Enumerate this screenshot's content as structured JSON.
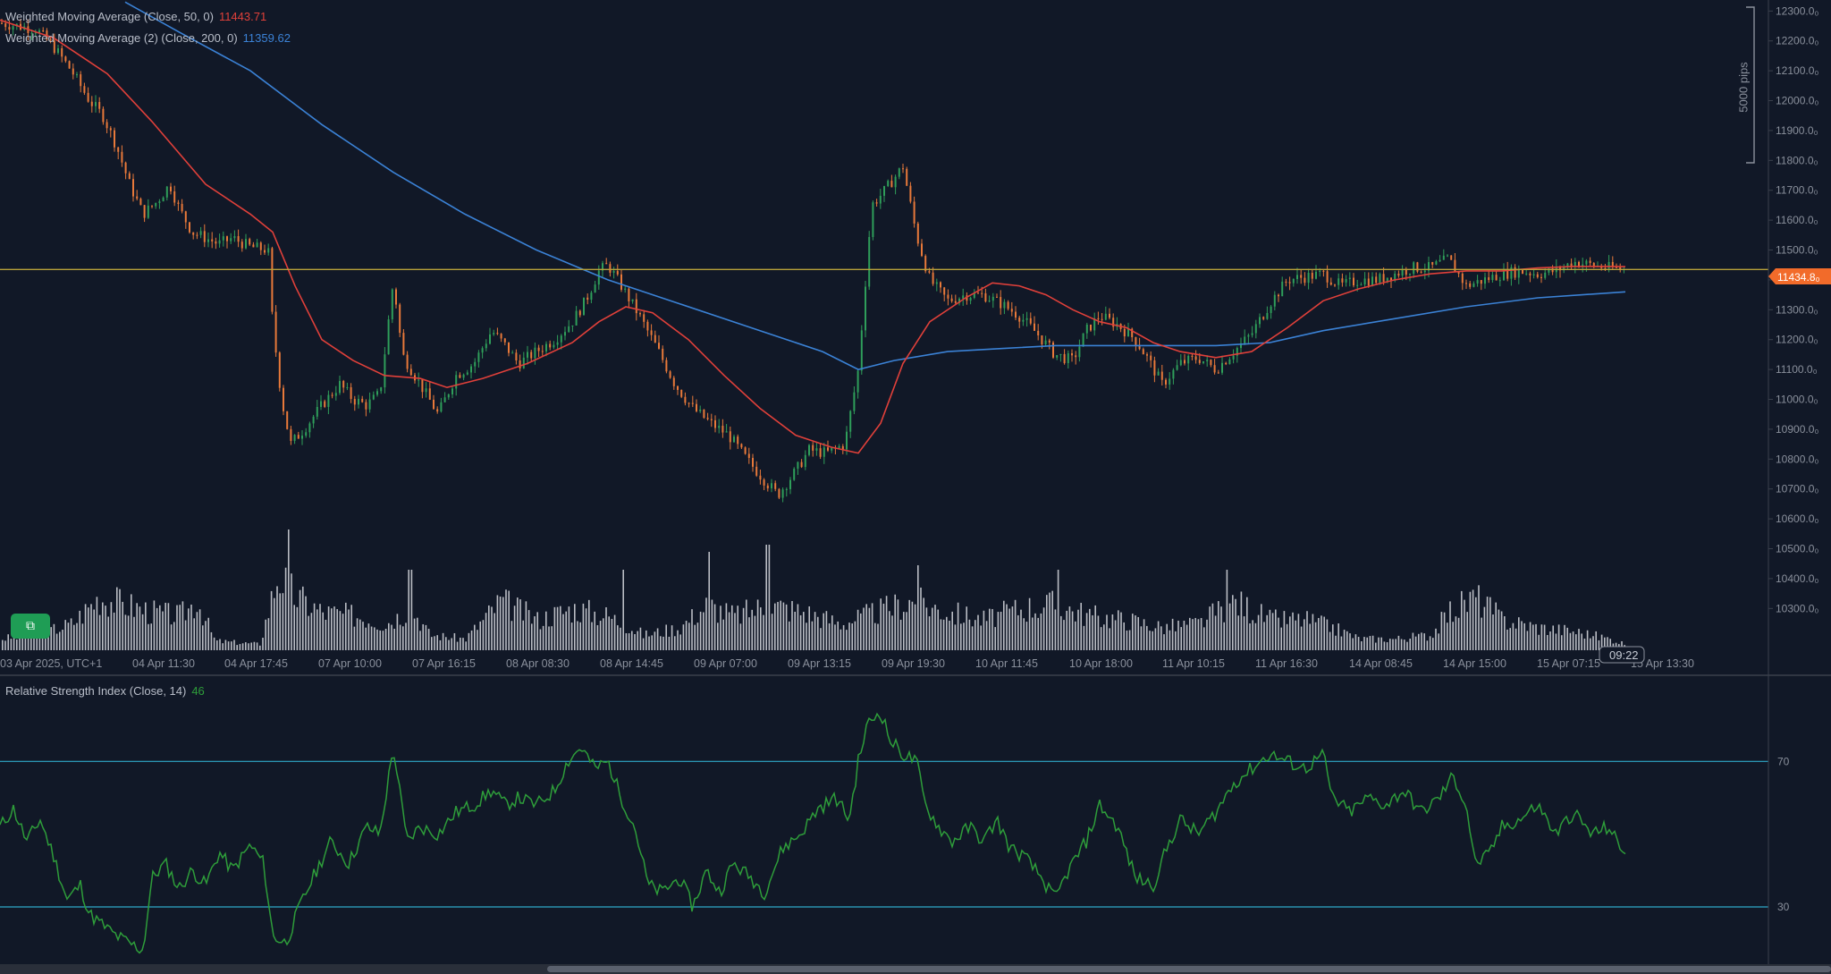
{
  "indicators": {
    "wma50": {
      "label": "Weighted Moving Average (Close, 50, 0)",
      "value": "11443.71",
      "color": "#e0403a"
    },
    "wma200": {
      "label": "Weighted Moving Average (2) (Close, 200, 0)",
      "value": "11359.62",
      "color": "#3b82d6"
    },
    "rsi": {
      "label": "Relative Strength Index (Close, 14)",
      "value": "46",
      "color": "#2e9d3a"
    }
  },
  "price_badge": "11434.8₀",
  "measure_label": "5000 pips",
  "time_badge": "09:22",
  "chart_data": {
    "type": "candlestick",
    "price_axis": {
      "ticks": [
        "12300.0₀",
        "12200.0₀",
        "12100.0₀",
        "12000.0₀",
        "11900.0₀",
        "11800.0₀",
        "11700.0₀",
        "11600.0₀",
        "11500.0₀",
        "11400.0₀",
        "11300.0₀",
        "11200.0₀",
        "11100.0₀",
        "11000.0₀",
        "10900.0₀",
        "10800.0₀",
        "10700.0₀",
        "10600.0₀",
        "10500.0₀",
        "10400.0₀",
        "10300.0₀"
      ],
      "ylim": [
        10250,
        12310
      ]
    },
    "time_axis": [
      "03 Apr 2025, UTC+1",
      "04 Apr 11:30",
      "04 Apr 17:45",
      "07 Apr 10:00",
      "07 Apr 16:15",
      "08 Apr 08:30",
      "08 Apr 14:45",
      "09 Apr 07:00",
      "09 Apr 13:15",
      "09 Apr 19:30",
      "10 Apr 11:45",
      "10 Apr 18:00",
      "11 Apr 10:15",
      "11 Apr 16:30",
      "14 Apr 08:45",
      "14 Apr 15:00",
      "15 Apr 07:15",
      "15 Apr 13:30"
    ],
    "horizontal_line": {
      "price": 11434.8,
      "color": "#b8a23a"
    },
    "price_path": [
      [
        0,
        12260
      ],
      [
        20,
        12250
      ],
      [
        40,
        12240
      ],
      [
        60,
        12180
      ],
      [
        80,
        12100
      ],
      [
        100,
        12000
      ],
      [
        115,
        11950
      ],
      [
        130,
        11850
      ],
      [
        145,
        11720
      ],
      [
        160,
        11620
      ],
      [
        175,
        11660
      ],
      [
        190,
        11720
      ],
      [
        200,
        11640
      ],
      [
        215,
        11560
      ],
      [
        230,
        11540
      ],
      [
        245,
        11520
      ],
      [
        260,
        11540
      ],
      [
        280,
        11510
      ],
      [
        300,
        11500
      ],
      [
        305,
        11250
      ],
      [
        315,
        11000
      ],
      [
        325,
        10850
      ],
      [
        340,
        10900
      ],
      [
        360,
        10980
      ],
      [
        380,
        11050
      ],
      [
        395,
        11000
      ],
      [
        410,
        10980
      ],
      [
        425,
        11020
      ],
      [
        440,
        11400
      ],
      [
        450,
        11150
      ],
      [
        470,
        11050
      ],
      [
        490,
        10950
      ],
      [
        510,
        11080
      ],
      [
        530,
        11120
      ],
      [
        550,
        11230
      ],
      [
        565,
        11180
      ],
      [
        580,
        11120
      ],
      [
        600,
        11160
      ],
      [
        620,
        11200
      ],
      [
        640,
        11260
      ],
      [
        655,
        11330
      ],
      [
        670,
        11430
      ],
      [
        680,
        11450
      ],
      [
        695,
        11380
      ],
      [
        715,
        11280
      ],
      [
        735,
        11170
      ],
      [
        755,
        11050
      ],
      [
        775,
        10970
      ],
      [
        795,
        10920
      ],
      [
        815,
        10880
      ],
      [
        835,
        10800
      ],
      [
        855,
        10730
      ],
      [
        870,
        10680
      ],
      [
        890,
        10760
      ],
      [
        905,
        10830
      ],
      [
        925,
        10820
      ],
      [
        945,
        10850
      ],
      [
        960,
        11100
      ],
      [
        975,
        11650
      ],
      [
        990,
        11700
      ],
      [
        1010,
        11780
      ],
      [
        1025,
        11550
      ],
      [
        1040,
        11400
      ],
      [
        1060,
        11330
      ],
      [
        1080,
        11350
      ],
      [
        1100,
        11350
      ],
      [
        1120,
        11320
      ],
      [
        1140,
        11280
      ],
      [
        1160,
        11220
      ],
      [
        1180,
        11150
      ],
      [
        1200,
        11130
      ],
      [
        1215,
        11230
      ],
      [
        1230,
        11280
      ],
      [
        1250,
        11250
      ],
      [
        1270,
        11200
      ],
      [
        1285,
        11130
      ],
      [
        1300,
        11050
      ],
      [
        1320,
        11120
      ],
      [
        1340,
        11140
      ],
      [
        1360,
        11100
      ],
      [
        1380,
        11160
      ],
      [
        1400,
        11220
      ],
      [
        1420,
        11320
      ],
      [
        1440,
        11400
      ],
      [
        1460,
        11410
      ],
      [
        1480,
        11420
      ],
      [
        1500,
        11380
      ],
      [
        1520,
        11400
      ],
      [
        1540,
        11400
      ],
      [
        1560,
        11420
      ],
      [
        1580,
        11440
      ],
      [
        1600,
        11440
      ],
      [
        1620,
        11470
      ],
      [
        1640,
        11380
      ],
      [
        1660,
        11400
      ],
      [
        1680,
        11420
      ],
      [
        1700,
        11430
      ],
      [
        1720,
        11420
      ],
      [
        1740,
        11430
      ],
      [
        1760,
        11460
      ],
      [
        1780,
        11450
      ],
      [
        1800,
        11440
      ],
      [
        1818,
        11435
      ]
    ],
    "wma50_path": [
      [
        0,
        12270
      ],
      [
        60,
        12210
      ],
      [
        120,
        12090
      ],
      [
        170,
        11930
      ],
      [
        230,
        11720
      ],
      [
        280,
        11620
      ],
      [
        305,
        11560
      ],
      [
        330,
        11380
      ],
      [
        360,
        11200
      ],
      [
        395,
        11130
      ],
      [
        430,
        11080
      ],
      [
        470,
        11070
      ],
      [
        500,
        11040
      ],
      [
        540,
        11070
      ],
      [
        590,
        11120
      ],
      [
        640,
        11190
      ],
      [
        670,
        11260
      ],
      [
        700,
        11310
      ],
      [
        730,
        11290
      ],
      [
        770,
        11200
      ],
      [
        810,
        11080
      ],
      [
        850,
        10970
      ],
      [
        890,
        10880
      ],
      [
        930,
        10840
      ],
      [
        960,
        10820
      ],
      [
        985,
        10920
      ],
      [
        1010,
        11120
      ],
      [
        1040,
        11260
      ],
      [
        1080,
        11340
      ],
      [
        1110,
        11390
      ],
      [
        1140,
        11380
      ],
      [
        1170,
        11350
      ],
      [
        1200,
        11300
      ],
      [
        1230,
        11260
      ],
      [
        1260,
        11240
      ],
      [
        1290,
        11190
      ],
      [
        1320,
        11160
      ],
      [
        1360,
        11140
      ],
      [
        1400,
        11160
      ],
      [
        1440,
        11240
      ],
      [
        1480,
        11330
      ],
      [
        1520,
        11370
      ],
      [
        1560,
        11400
      ],
      [
        1600,
        11420
      ],
      [
        1640,
        11430
      ],
      [
        1680,
        11430
      ],
      [
        1720,
        11440
      ],
      [
        1760,
        11445
      ],
      [
        1800,
        11445
      ],
      [
        1818,
        11444
      ]
    ],
    "wma200_path": [
      [
        140,
        12330
      ],
      [
        200,
        12230
      ],
      [
        280,
        12100
      ],
      [
        360,
        11920
      ],
      [
        440,
        11760
      ],
      [
        520,
        11620
      ],
      [
        600,
        11500
      ],
      [
        680,
        11400
      ],
      [
        760,
        11320
      ],
      [
        840,
        11240
      ],
      [
        920,
        11160
      ],
      [
        960,
        11100
      ],
      [
        1000,
        11130
      ],
      [
        1060,
        11160
      ],
      [
        1120,
        11170
      ],
      [
        1180,
        11180
      ],
      [
        1240,
        11180
      ],
      [
        1300,
        11180
      ],
      [
        1360,
        11180
      ],
      [
        1420,
        11190
      ],
      [
        1480,
        11230
      ],
      [
        1560,
        11270
      ],
      [
        1640,
        11310
      ],
      [
        1720,
        11340
      ],
      [
        1818,
        11360
      ]
    ],
    "volume_envelope": [
      [
        0,
        15
      ],
      [
        40,
        20
      ],
      [
        80,
        35
      ],
      [
        110,
        70
      ],
      [
        140,
        60
      ],
      [
        170,
        50
      ],
      [
        200,
        45
      ],
      [
        220,
        65
      ],
      [
        240,
        12
      ],
      [
        290,
        8
      ],
      [
        310,
        100
      ],
      [
        330,
        70
      ],
      [
        360,
        50
      ],
      [
        400,
        45
      ],
      [
        430,
        35
      ],
      [
        460,
        55
      ],
      [
        480,
        20
      ],
      [
        520,
        15
      ],
      [
        560,
        65
      ],
      [
        600,
        40
      ],
      [
        640,
        55
      ],
      [
        680,
        45
      ],
      [
        720,
        20
      ],
      [
        760,
        30
      ],
      [
        790,
        60
      ],
      [
        820,
        45
      ],
      [
        860,
        60
      ],
      [
        900,
        50
      ],
      [
        940,
        35
      ],
      [
        980,
        50
      ],
      [
        1020,
        65
      ],
      [
        1060,
        50
      ],
      [
        1100,
        40
      ],
      [
        1140,
        55
      ],
      [
        1180,
        60
      ],
      [
        1220,
        45
      ],
      [
        1260,
        40
      ],
      [
        1300,
        30
      ],
      [
        1340,
        35
      ],
      [
        1380,
        65
      ],
      [
        1420,
        40
      ],
      [
        1460,
        40
      ],
      [
        1490,
        30
      ],
      [
        1520,
        15
      ],
      [
        1560,
        15
      ],
      [
        1600,
        20
      ],
      [
        1620,
        50
      ],
      [
        1650,
        70
      ],
      [
        1680,
        40
      ],
      [
        1720,
        30
      ],
      [
        1760,
        25
      ],
      [
        1800,
        15
      ],
      [
        1818,
        8
      ]
    ],
    "volume_spikes": [
      [
        322,
        135
      ],
      [
        458,
        90
      ],
      [
        695,
        90
      ],
      [
        792,
        110
      ],
      [
        858,
        118
      ],
      [
        1026,
        95
      ],
      [
        1182,
        90
      ],
      [
        1372,
        90
      ]
    ],
    "rsi": {
      "levels": [
        70,
        30
      ],
      "ylim": [
        15,
        90
      ],
      "path": [
        [
          0,
          52
        ],
        [
          15,
          57
        ],
        [
          30,
          48
        ],
        [
          45,
          54
        ],
        [
          60,
          44
        ],
        [
          75,
          32
        ],
        [
          90,
          36
        ],
        [
          100,
          28
        ],
        [
          115,
          25
        ],
        [
          130,
          22
        ],
        [
          145,
          20
        ],
        [
          160,
          18
        ],
        [
          170,
          38
        ],
        [
          185,
          42
        ],
        [
          200,
          35
        ],
        [
          215,
          40
        ],
        [
          230,
          36
        ],
        [
          245,
          45
        ],
        [
          260,
          40
        ],
        [
          280,
          47
        ],
        [
          295,
          42
        ],
        [
          305,
          22
        ],
        [
          320,
          20
        ],
        [
          335,
          30
        ],
        [
          350,
          38
        ],
        [
          370,
          48
        ],
        [
          390,
          42
        ],
        [
          410,
          52
        ],
        [
          425,
          50
        ],
        [
          440,
          74
        ],
        [
          455,
          48
        ],
        [
          470,
          52
        ],
        [
          490,
          50
        ],
        [
          510,
          56
        ],
        [
          530,
          58
        ],
        [
          550,
          62
        ],
        [
          565,
          58
        ],
        [
          580,
          60
        ],
        [
          600,
          58
        ],
        [
          620,
          62
        ],
        [
          635,
          70
        ],
        [
          650,
          74
        ],
        [
          665,
          68
        ],
        [
          680,
          70
        ],
        [
          695,
          60
        ],
        [
          710,
          52
        ],
        [
          725,
          36
        ],
        [
          740,
          34
        ],
        [
          760,
          38
        ],
        [
          775,
          30
        ],
        [
          790,
          40
        ],
        [
          805,
          34
        ],
        [
          820,
          42
        ],
        [
          840,
          38
        ],
        [
          855,
          34
        ],
        [
          875,
          46
        ],
        [
          895,
          50
        ],
        [
          915,
          57
        ],
        [
          935,
          60
        ],
        [
          950,
          54
        ],
        [
          960,
          70
        ],
        [
          970,
          80
        ],
        [
          985,
          84
        ],
        [
          995,
          76
        ],
        [
          1010,
          72
        ],
        [
          1025,
          70
        ],
        [
          1035,
          58
        ],
        [
          1050,
          52
        ],
        [
          1065,
          48
        ],
        [
          1085,
          52
        ],
        [
          1100,
          48
        ],
        [
          1115,
          54
        ],
        [
          1130,
          46
        ],
        [
          1145,
          44
        ],
        [
          1165,
          38
        ],
        [
          1180,
          32
        ],
        [
          1195,
          40
        ],
        [
          1215,
          48
        ],
        [
          1230,
          58
        ],
        [
          1250,
          52
        ],
        [
          1270,
          38
        ],
        [
          1290,
          36
        ],
        [
          1305,
          46
        ],
        [
          1320,
          54
        ],
        [
          1340,
          50
        ],
        [
          1360,
          56
        ],
        [
          1380,
          64
        ],
        [
          1400,
          68
        ],
        [
          1420,
          72
        ],
        [
          1440,
          70
        ],
        [
          1460,
          68
        ],
        [
          1480,
          72
        ],
        [
          1490,
          60
        ],
        [
          1510,
          56
        ],
        [
          1530,
          60
        ],
        [
          1550,
          58
        ],
        [
          1570,
          62
        ],
        [
          1590,
          56
        ],
        [
          1610,
          60
        ],
        [
          1625,
          66
        ],
        [
          1640,
          58
        ],
        [
          1650,
          42
        ],
        [
          1665,
          44
        ],
        [
          1680,
          52
        ],
        [
          1700,
          54
        ],
        [
          1720,
          58
        ],
        [
          1740,
          50
        ],
        [
          1760,
          56
        ],
        [
          1780,
          50
        ],
        [
          1800,
          52
        ],
        [
          1812,
          46
        ],
        [
          1818,
          46
        ]
      ]
    }
  }
}
